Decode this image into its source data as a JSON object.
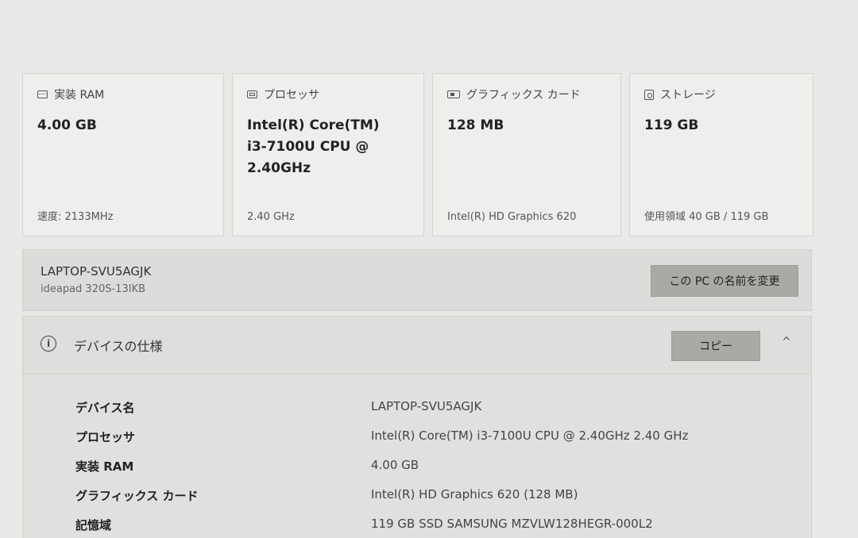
{
  "cards": [
    {
      "title": "実装 RAM",
      "icon": "ram-icon",
      "value": "4.00 GB",
      "footer": "速度: 2133MHz"
    },
    {
      "title": "プロセッサ",
      "icon": "cpu-icon",
      "value": "Intel(R) Core(TM) i3-7100U CPU @ 2.40GHz",
      "footer": "2.40 GHz"
    },
    {
      "title": "グラフィックス カード",
      "icon": "graphics-card-icon",
      "value": "128 MB",
      "footer": "Intel(R) HD Graphics 620"
    },
    {
      "title": "ストレージ",
      "icon": "storage-icon",
      "value": "119 GB",
      "footer": "使用領域 40 GB / 119 GB"
    }
  ],
  "device": {
    "name": "LAPTOP-SVU5AGJK",
    "model": "ideapad 320S-13IKB",
    "rename_label": "この PC の名前を変更"
  },
  "specs": {
    "title": "デバイスの仕様",
    "copy_label": "コピー",
    "collapse_glyph": "^",
    "info_glyph": "i",
    "rows": [
      {
        "label": "デバイス名",
        "value": "LAPTOP-SVU5AGJK"
      },
      {
        "label": "プロセッサ",
        "value": "Intel(R) Core(TM) i3-7100U CPU @ 2.40GHz   2.40 GHz"
      },
      {
        "label": "実装 RAM",
        "value": "4.00 GB"
      },
      {
        "label": "グラフィックス カード",
        "value": "Intel(R) HD Graphics 620 (128 MB)"
      },
      {
        "label": "記憶域",
        "value": "119 GB SSD SAMSUNG MZVLW128HEGR-000L2"
      }
    ]
  }
}
